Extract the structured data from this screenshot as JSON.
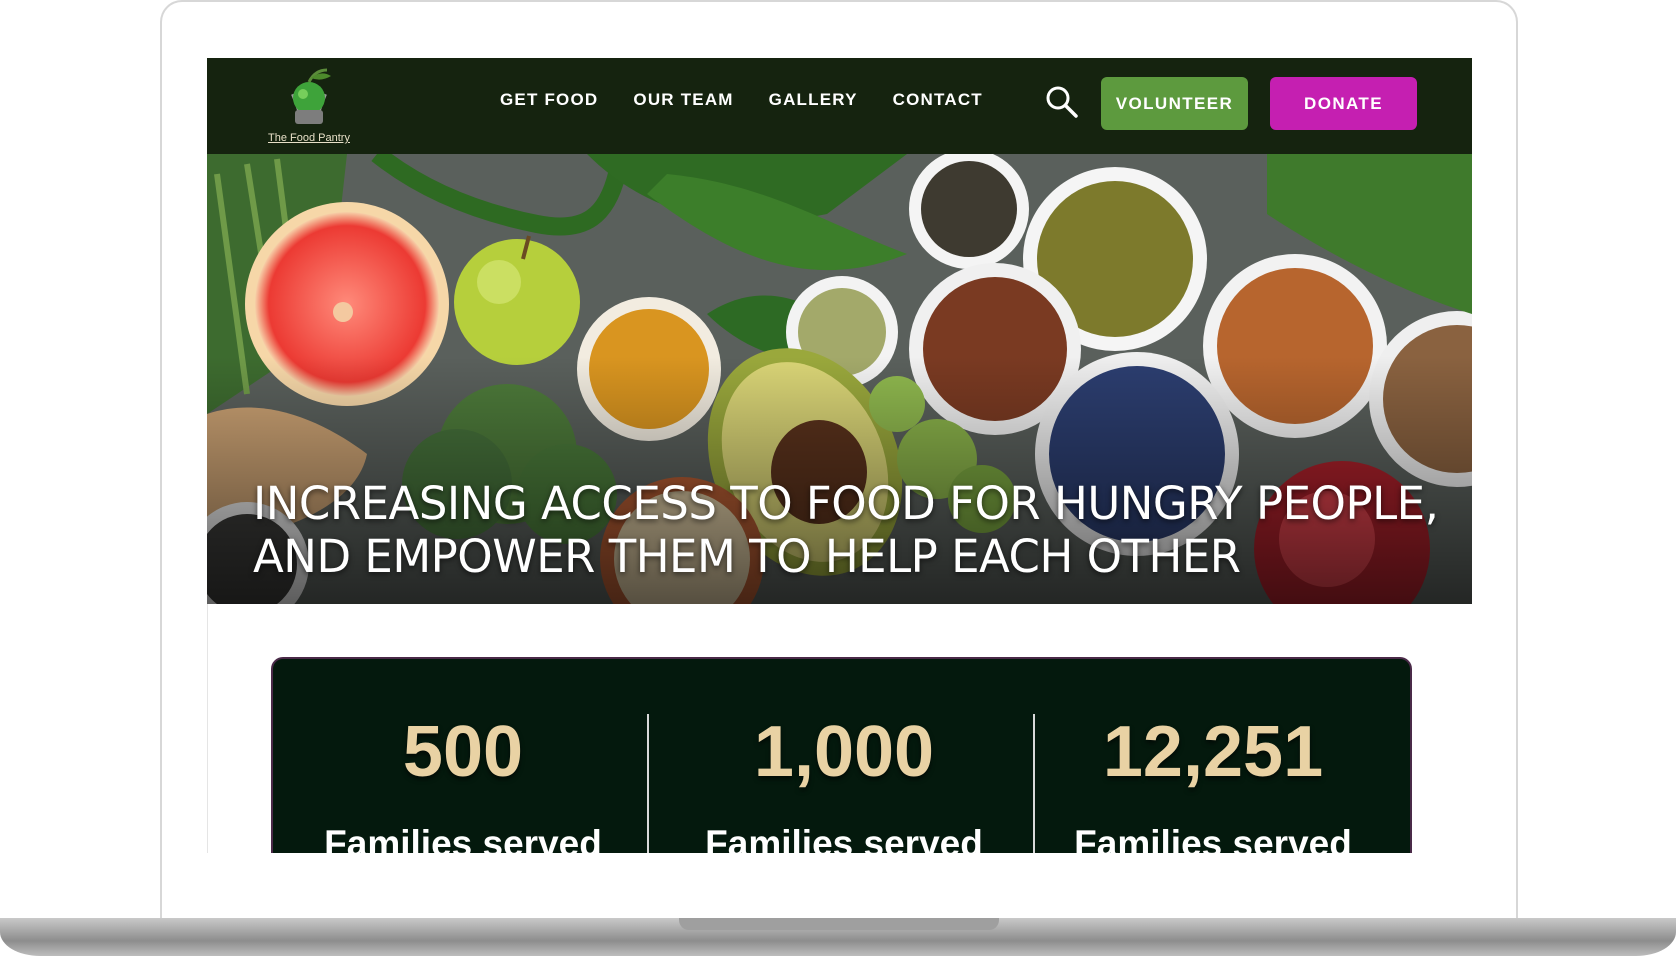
{
  "brand": {
    "logo_text": "The Food Pantry"
  },
  "nav": {
    "links": [
      "GET FOOD",
      "OUR TEAM",
      "GALLERY",
      "CONTACT"
    ],
    "volunteer_label": "VOLUNTEER",
    "donate_label": "DONATE",
    "search_icon": "search-icon"
  },
  "hero": {
    "line1": "INCREASING ACCESS TO FOOD FOR HUNGRY PEOPLE,",
    "line2": "AND EMPOWER THEM TO HELP EACH OTHER"
  },
  "stats": [
    {
      "value": "500",
      "label": "Families served"
    },
    {
      "value": "1,000",
      "label": "Families served"
    },
    {
      "value": "12,251",
      "label": "Families served"
    }
  ],
  "colors": {
    "nav_bg": "#15230f",
    "volunteer": "#5d9a3e",
    "donate": "#c51fb1",
    "stats_bg": "#04190d",
    "stat_value": "#e9d2a4"
  }
}
